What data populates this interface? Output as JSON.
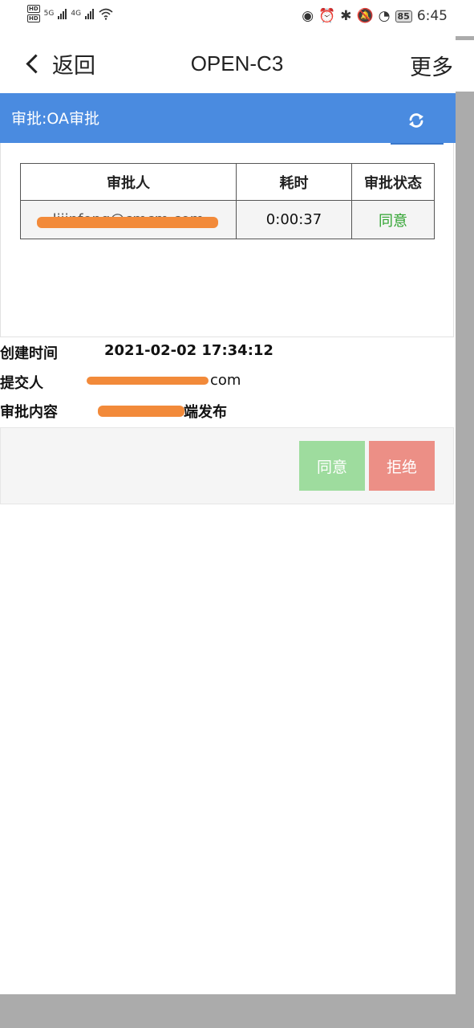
{
  "statusbar": {
    "hd1": "HD",
    "hd2": "HD",
    "net1": "5G",
    "net2": "4G",
    "battery": "85",
    "time": "6:45"
  },
  "nav": {
    "back_label": "返回",
    "title": "OPEN-C3",
    "more_label": "更多"
  },
  "panel": {
    "title": "审批:OA审批",
    "refresh_icon": "refresh-icon"
  },
  "table": {
    "headers": [
      "审批人",
      "耗时",
      "审批状态"
    ],
    "rows": [
      {
        "approver": "lijinfeng@cmcm.com",
        "duration": "0:00:37",
        "status": "同意"
      }
    ]
  },
  "info": {
    "created_label": "创建时间",
    "created_value": "2021-02-02 17:34:12",
    "submitter_label": "提交人",
    "submitter_value": "com",
    "content_label": "审批内容",
    "content_value": "端发布"
  },
  "actions": {
    "agree": "同意",
    "reject": "拒绝"
  },
  "colors": {
    "header_blue": "#4a8be0",
    "agree_green": "#9edc9e",
    "reject_red": "#ec8f86",
    "redaction_orange": "#f28a3a"
  }
}
